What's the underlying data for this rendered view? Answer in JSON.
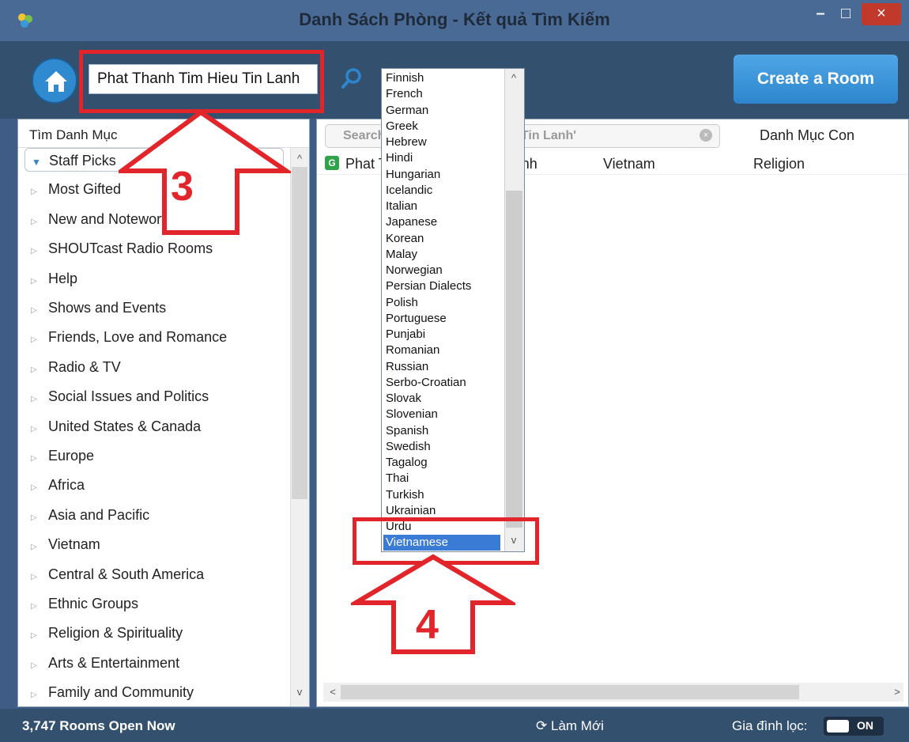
{
  "window": {
    "title": "Danh Sách Phòng - Kết quả Tìm Kiếm",
    "min": "–",
    "max": "□",
    "close": "×"
  },
  "header": {
    "search_value": "Phat Thanh Tim Hieu Tin Lanh",
    "create_label": "Create a Room"
  },
  "left": {
    "header": "Tìm Danh Mục",
    "categories": [
      "Staff Picks",
      "Most Gifted",
      "New and Noteworthy",
      "SHOUTcast Radio Rooms",
      "Help",
      "Shows and Events",
      "Friends, Love and Romance",
      "Radio & TV",
      "Social Issues and Politics",
      "United States & Canada",
      "Europe",
      "Africa",
      "Asia and Pacific",
      "Vietnam",
      "Central & South America",
      "Ethnic Groups",
      "Religion & Spirituality",
      "Arts & Entertainment",
      "Family and Community"
    ]
  },
  "right": {
    "search_text": "Search 'Phat Thanh Tim Hieu Tin Lanh'",
    "subcategory_label": "Danh Mục Con",
    "row": {
      "name": "Phat Thanh Tim Hieu Tin Lanh",
      "country": "Vietnam",
      "category": "Religion"
    }
  },
  "dropdown": {
    "options": [
      "Finnish",
      "French",
      "German",
      "Greek",
      "Hebrew",
      "Hindi",
      "Hungarian",
      "Icelandic",
      "Italian",
      "Japanese",
      "Korean",
      "Malay",
      "Norwegian",
      "Persian Dialects",
      "Polish",
      "Portuguese",
      "Punjabi",
      "Romanian",
      "Russian",
      "Serbo-Croatian",
      "Slovak",
      "Slovenian",
      "Spanish",
      "Swedish",
      "Tagalog",
      "Thai",
      "Turkish",
      "Ukrainian",
      "Urdu",
      "Vietnamese"
    ],
    "selected": "Vietnamese"
  },
  "status": {
    "rooms": "3,747 Rooms Open Now",
    "refresh": "Làm Mới",
    "filter": "Gia đình lọc:",
    "toggle": "ON"
  },
  "annotations": {
    "step3": "3",
    "step4": "4",
    "color": "#e2252b"
  }
}
